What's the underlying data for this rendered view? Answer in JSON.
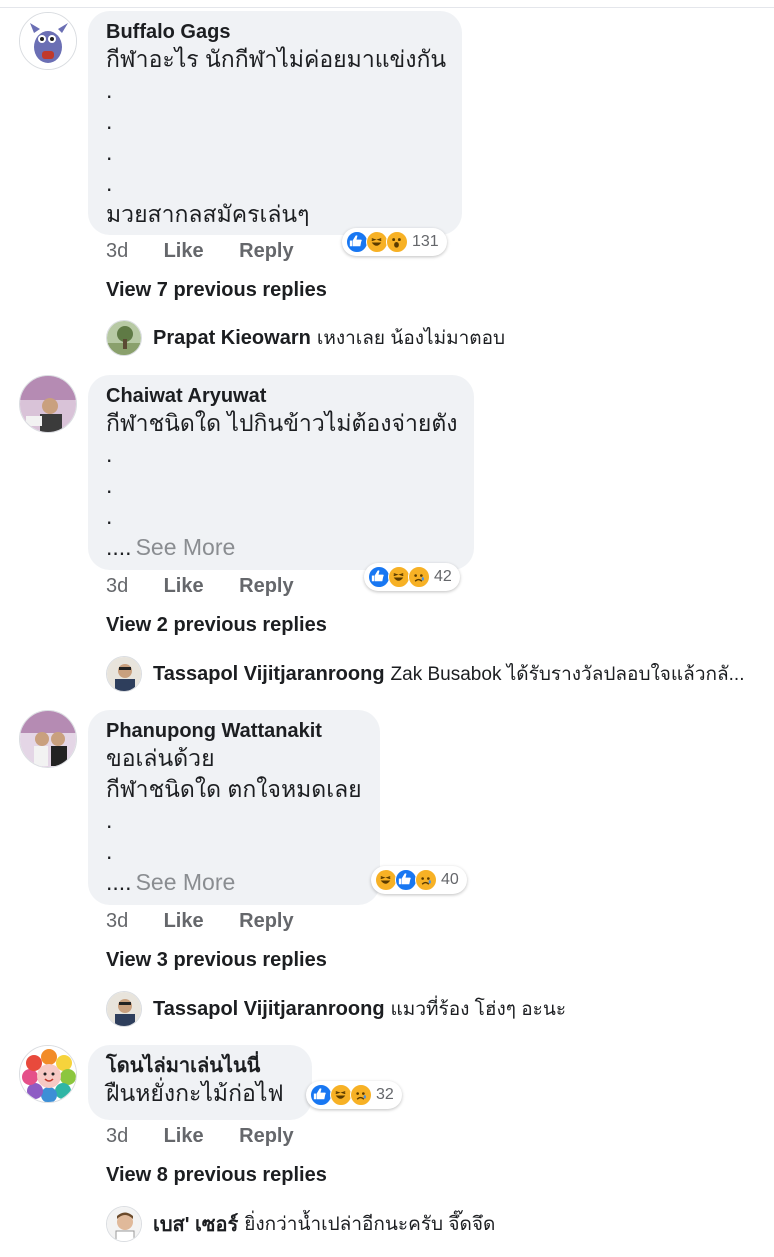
{
  "comments": [
    {
      "author": "Buffalo Gags",
      "lines": [
        "กีฬาอะไร นักกีฬาไม่ค่อยมาแข่งกัน",
        ".",
        ".",
        ".",
        ".",
        "มวยสากลสมัครเล่นๆ"
      ],
      "see_more_dots": "",
      "see_more_label": "",
      "reaction_icons": [
        "like-icon",
        "haha-icon",
        "wow-icon"
      ],
      "reaction_count": "131",
      "time": "3d",
      "like_label": "Like",
      "reply_label": "Reply",
      "view_replies": "View 7 previous replies",
      "reply": {
        "name": "Prapat Kieowarn",
        "text": "เหงาเลย น้องไม่มาตอบ"
      }
    },
    {
      "author": "Chaiwat Aryuwat",
      "lines": [
        "กีฬาชนิดใด ไปกินข้าวไม่ต้องจ่ายตัง",
        ".",
        ".",
        "."
      ],
      "see_more_dots": "....",
      "see_more_label": "See More",
      "reaction_icons": [
        "like-icon",
        "haha-icon",
        "sad-icon"
      ],
      "reaction_count": "42",
      "time": "3d",
      "like_label": "Like",
      "reply_label": "Reply",
      "view_replies": "View 2 previous replies",
      "reply": {
        "name": "Tassapol Vijitjaranroong",
        "text": "Zak Busabok ได้รับรางวัลปลอบใจแล้วกลั..."
      }
    },
    {
      "author": "Phanupong Wattanakit",
      "lines": [
        "ขอเล่นด้วย",
        "กีฬาชนิดใด ตกใจหมดเลย",
        ".",
        "."
      ],
      "see_more_dots": "....",
      "see_more_label": "See More",
      "reaction_icons": [
        "haha-icon",
        "like-icon",
        "sad-icon"
      ],
      "reaction_count": "40",
      "time": "3d",
      "like_label": "Like",
      "reply_label": "Reply",
      "view_replies": "View 3 previous replies",
      "reply": {
        "name": "Tassapol Vijitjaranroong",
        "text": "แมวที่ร้อง โฮ่งๆ อะนะ"
      }
    },
    {
      "author": "โดนไล่มาเล่นไนนี่",
      "lines": [
        "ฝืนหยั่งกะไม้ก่อไฟ"
      ],
      "see_more_dots": "",
      "see_more_label": "",
      "reaction_icons": [
        "like-icon",
        "haha-icon",
        "sad-icon"
      ],
      "reaction_count": "32",
      "time": "3d",
      "like_label": "Like",
      "reply_label": "Reply",
      "view_replies": "View 8 previous replies",
      "reply": {
        "name": "เบส' เซอร์",
        "text": "ยิ่งกว่าน้ำเปล่าอีกนะครับ จึ๊ดจึด"
      }
    }
  ]
}
